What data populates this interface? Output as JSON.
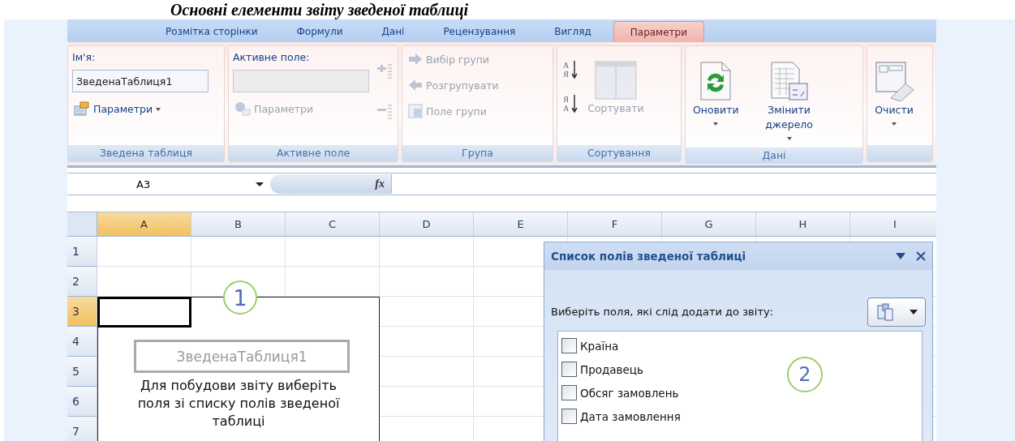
{
  "heading": "Основні елементи звіту зведеної таблиці",
  "tabs": [
    {
      "label": "Розмітка сторінки",
      "selected": false
    },
    {
      "label": "Формули",
      "selected": false
    },
    {
      "label": "Дані",
      "selected": false
    },
    {
      "label": "Рецензування",
      "selected": false
    },
    {
      "label": "Вигляд",
      "selected": false
    },
    {
      "label": "Параметри",
      "selected": true
    }
  ],
  "ribbon_groups": [
    {
      "title": "Зведена таблиця",
      "columns": [
        [
          {
            "kind": "label",
            "text": "Ім'я:",
            "disabled": false
          },
          {
            "kind": "field",
            "value": "ЗведенаТаблиця1",
            "disabled": false
          },
          {
            "kind": "small",
            "label": "Параметри",
            "dropdown": true,
            "disabled": false
          }
        ]
      ]
    },
    {
      "title": "Активне поле",
      "columns": [
        [
          {
            "kind": "label",
            "text": "Активне поле:",
            "disabled": false
          },
          {
            "kind": "field",
            "disabled": true
          },
          {
            "kind": "small",
            "label": "Параметри",
            "dropdown": false,
            "disabled": true
          }
        ],
        [
          {
            "kind": "icon",
            "disabled": true
          },
          {
            "kind": "icon",
            "disabled": true
          }
        ]
      ]
    },
    {
      "title": "Група",
      "columns": [
        [
          {
            "kind": "small",
            "label": "Вибір групи",
            "dropdown": false,
            "disabled": true
          },
          {
            "kind": "small",
            "label": "Розгрупувати",
            "dropdown": false,
            "disabled": true
          },
          {
            "kind": "small",
            "label": "Поле групи",
            "dropdown": false,
            "disabled": true
          }
        ]
      ]
    },
    {
      "title": "Сортування",
      "columns": [
        [
          {
            "kind": "icon",
            "letters": [
              "А",
              "Я"
            ],
            "disabled": false
          },
          {
            "kind": "icon",
            "letters": [
              "Я",
              "А"
            ],
            "disabled": false
          }
        ],
        [
          {
            "kind": "large",
            "label": "Сортувати",
            "dropdown": false,
            "disabled": true
          }
        ]
      ]
    },
    {
      "title": "Дані",
      "columns": [
        [
          {
            "kind": "large",
            "label": "Оновити",
            "dropdown": true,
            "disabled": false
          }
        ],
        [
          {
            "kind": "large",
            "label": "Змінити джерело",
            "dropdown": true,
            "disabled": false
          }
        ]
      ]
    },
    {
      "columns": [
        [
          {
            "kind": "large",
            "label": "Очисти",
            "dropdown": true,
            "disabled": false
          }
        ]
      ]
    }
  ],
  "formula_bar": {
    "name_box": "A3",
    "fx": "fx"
  },
  "columns": [
    {
      "label": "A",
      "selected": true
    },
    {
      "label": "B",
      "selected": false
    },
    {
      "label": "C",
      "selected": false
    },
    {
      "label": "D",
      "selected": false
    },
    {
      "label": "E",
      "selected": false
    },
    {
      "label": "F",
      "selected": false
    },
    {
      "label": "G",
      "selected": false
    },
    {
      "label": "H",
      "selected": false
    },
    {
      "label": "I",
      "selected": false
    }
  ],
  "rows": [
    {
      "label": "1",
      "selected": false
    },
    {
      "label": "2",
      "selected": false
    },
    {
      "label": "3",
      "selected": true
    },
    {
      "label": "4",
      "selected": false
    },
    {
      "label": "5",
      "selected": false
    },
    {
      "label": "6",
      "selected": false
    },
    {
      "label": "7",
      "selected": false
    }
  ],
  "pivot_placeholder": {
    "callout": "1",
    "name": "ЗведенаТаблиця1",
    "instruction": "Для побудови звіту виберіть поля зі списку полів зведеної таблиці"
  },
  "field_list": {
    "title": "Список полів зведеної таблиці",
    "prompt": "Виберіть поля, які слід додати до звіту:",
    "callout": "2",
    "fields": [
      {
        "label": "Країна",
        "checked": false
      },
      {
        "label": "Продавець",
        "checked": false
      },
      {
        "label": "Обсяг замовлень",
        "checked": false
      },
      {
        "label": "Дата замовлення",
        "checked": false
      }
    ]
  }
}
